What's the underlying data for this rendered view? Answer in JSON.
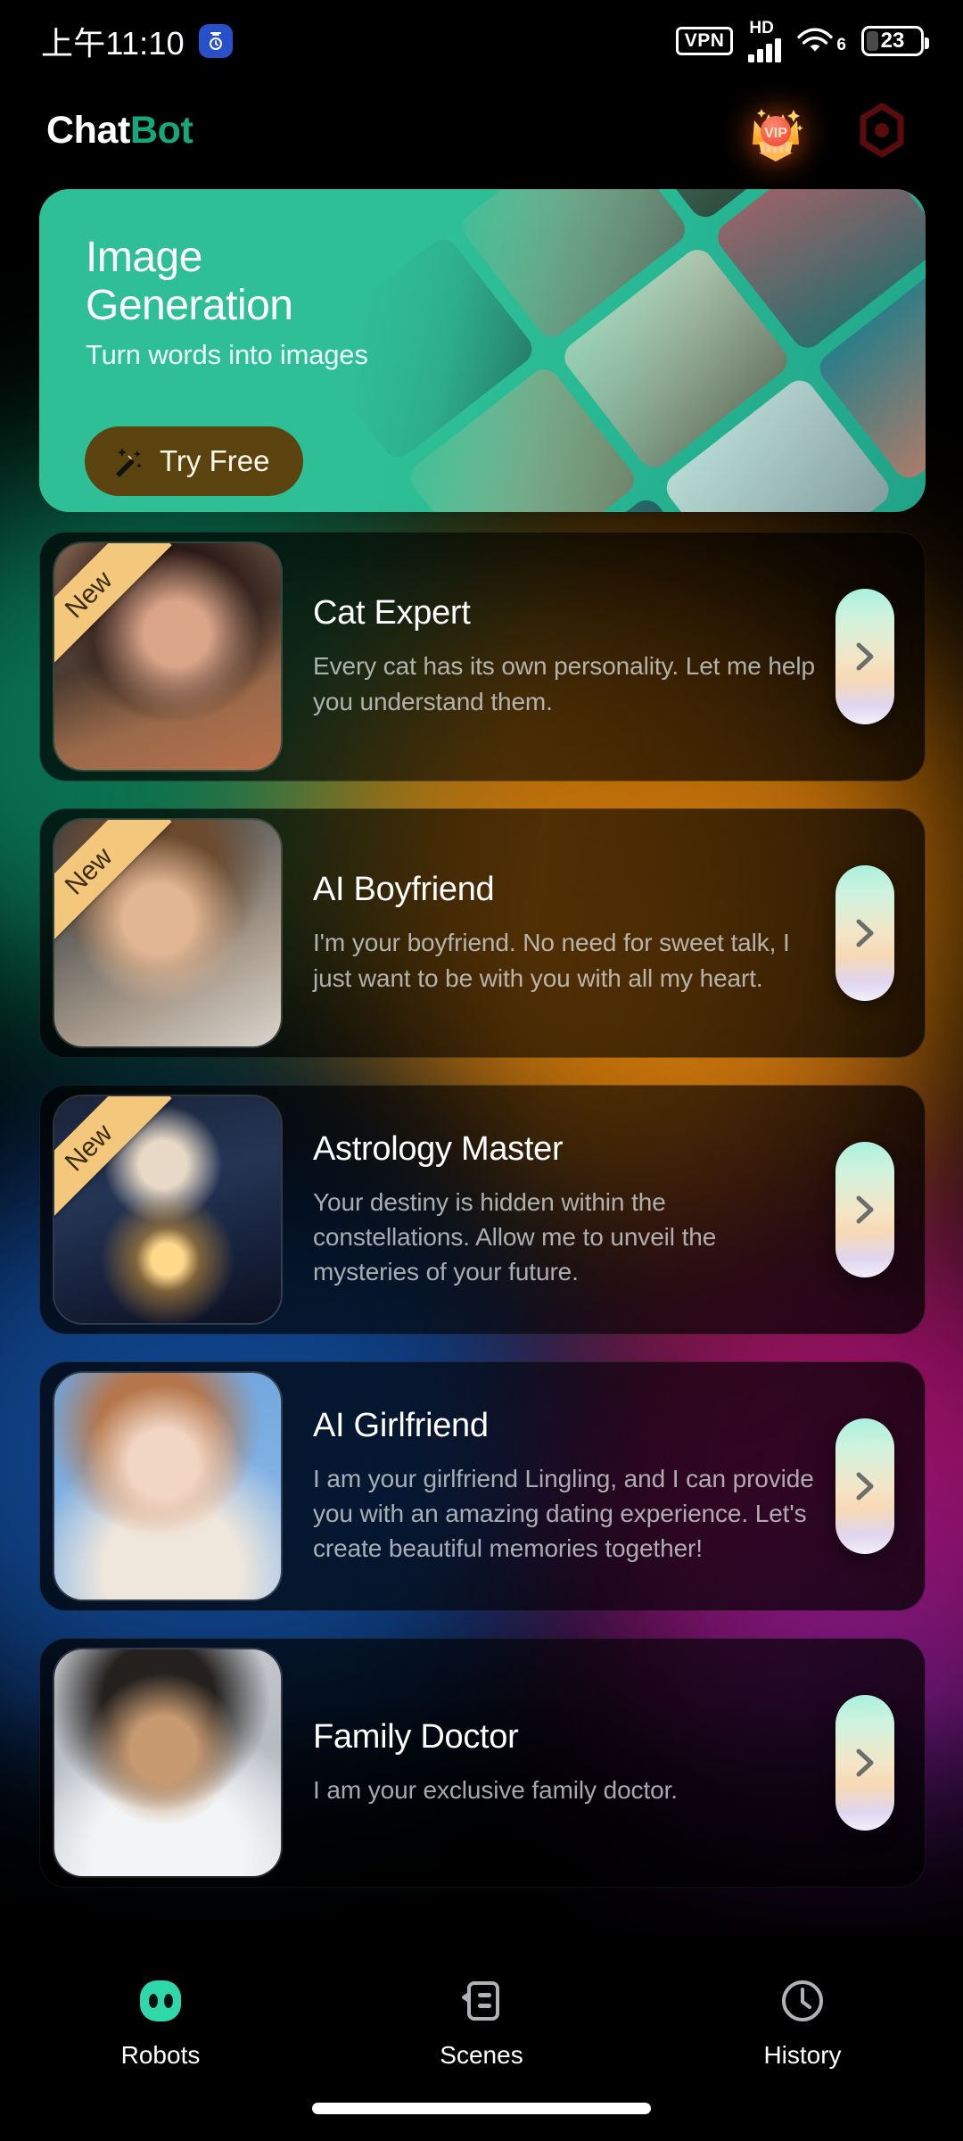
{
  "status_bar": {
    "time": "上午11:10",
    "app_icon": "alarm-app-icon",
    "vpn_label": "VPN",
    "hd_label": "HD",
    "signal_icon": "signal-bars-icon",
    "wifi_icon": "wifi-icon",
    "wifi_generation": "6",
    "battery_level": "23",
    "battery_icon": "battery-icon"
  },
  "header": {
    "brand_first": "Chat",
    "brand_second": "Bot",
    "vip_badge_label": "VIP",
    "vip_icon": "vip-crown-icon",
    "settings_icon": "hexagon-target-icon",
    "brand_accent_color": "#13a97c"
  },
  "banner": {
    "title_line1": "Image",
    "title_line2": "Generation",
    "subtitle": "Turn words into images",
    "cta_label": "Try Free",
    "cta_icon": "magic-wand-icon",
    "background_color": "#2fbf96",
    "cta_background_color": "#5b4410",
    "collage_icon": "image-collage"
  },
  "bots": [
    {
      "name": "Cat Expert",
      "description": "Every cat has its own personality. Let me help you understand them.",
      "badge": "New",
      "has_badge": true,
      "avatar_icon": "cat-expert-avatar",
      "chevron_icon": "chevron-right-icon"
    },
    {
      "name": "AI Boyfriend",
      "description": "I'm your boyfriend. No need for sweet talk, I just want to be with you with all my heart.",
      "badge": "New",
      "has_badge": true,
      "avatar_icon": "ai-boyfriend-avatar",
      "chevron_icon": "chevron-right-icon"
    },
    {
      "name": "Astrology Master",
      "description": "Your destiny is hidden within the constellations. Allow me to unveil the mysteries of your future.",
      "badge": "New",
      "has_badge": true,
      "avatar_icon": "astrology-master-avatar",
      "chevron_icon": "chevron-right-icon"
    },
    {
      "name": "AI Girlfriend",
      "description": "I am your girlfriend Lingling, and I can provide you with an amazing dating experience. Let's create beautiful memories together!",
      "badge": "",
      "has_badge": false,
      "avatar_icon": "ai-girlfriend-avatar",
      "chevron_icon": "chevron-right-icon"
    },
    {
      "name": "Family Doctor",
      "description": "I am your exclusive family doctor.",
      "badge": "",
      "has_badge": false,
      "avatar_icon": "family-doctor-avatar",
      "chevron_icon": "chevron-right-icon"
    }
  ],
  "bottom_nav": {
    "active_color": "#2fd8a8",
    "inactive_color": "#b0b3b6",
    "items": [
      {
        "label": "Robots",
        "icon": "robot-head-icon",
        "active": true
      },
      {
        "label": "Scenes",
        "icon": "scene-card-icon",
        "active": false
      },
      {
        "label": "History",
        "icon": "clock-icon",
        "active": false
      }
    ]
  }
}
